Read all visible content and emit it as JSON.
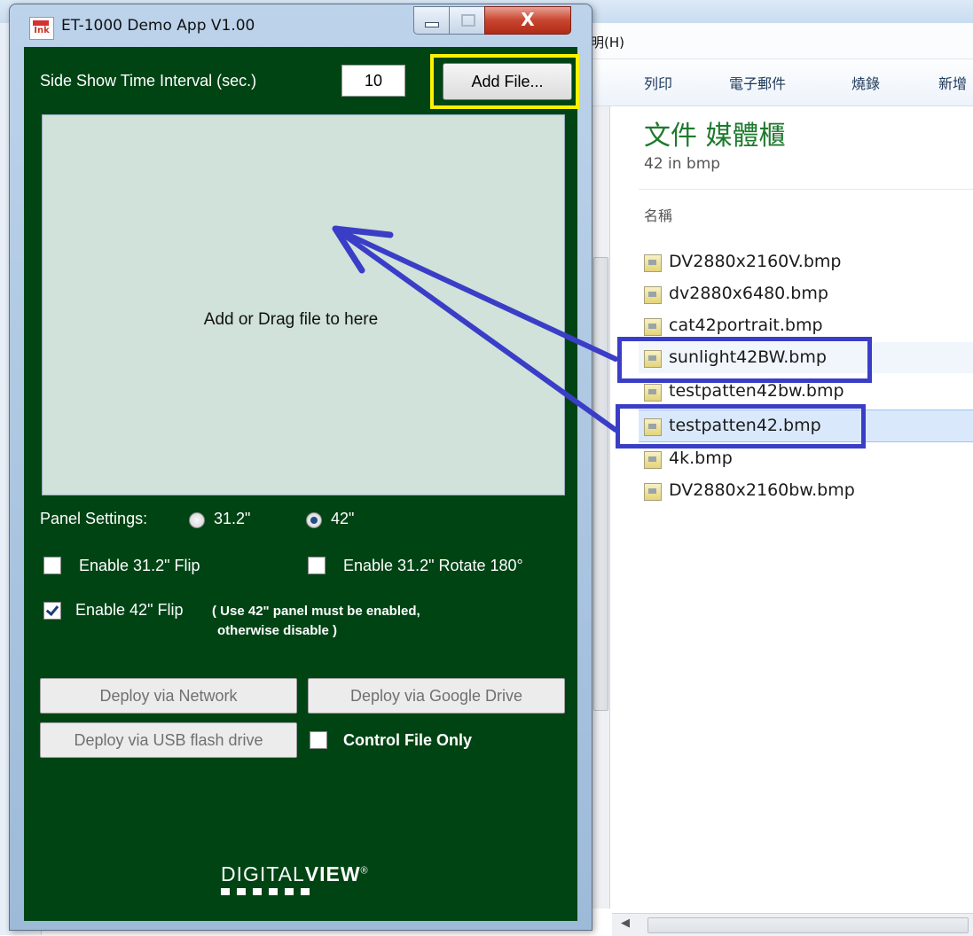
{
  "explorer": {
    "menu_help": "明(H)",
    "toolbar": [
      "列印",
      "電子郵件",
      "燒錄",
      "新增"
    ],
    "library_title": "文件 媒體櫃",
    "library_subtitle": "42 in bmp",
    "column_name": "名稱",
    "files": [
      {
        "name": "DV2880x2160V.bmp"
      },
      {
        "name": "dv2880x6480.bmp"
      },
      {
        "name": "cat42portrait.bmp"
      },
      {
        "name": "sunlight42BW.bmp"
      },
      {
        "name": "testpatten42bw.bmp"
      },
      {
        "name": "testpatten42.bmp"
      },
      {
        "name": "4k.bmp"
      },
      {
        "name": "DV2880x2160bw.bmp"
      }
    ]
  },
  "app": {
    "title": "ET-1000 Demo App V1.00",
    "icon_text": "Ink",
    "close_glyph": "X",
    "interval_label": "Side Show Time Interval (sec.)",
    "interval_value": "10",
    "add_file_label": "Add File...",
    "drop_text": "Add or Drag file to here",
    "panel_label": "Panel Settings:",
    "panel_options": [
      {
        "label": "31.2\"",
        "selected": false
      },
      {
        "label": "42\"",
        "selected": true
      }
    ],
    "enable_312_flip": {
      "label": "Enable 31.2\" Flip",
      "checked": false
    },
    "enable_312_rotate": {
      "label": "Enable 31.2\" Rotate 180°",
      "checked": false
    },
    "enable_42_flip": {
      "label": "Enable 42\" Flip",
      "checked": true
    },
    "note_line1": "( Use 42\" panel must be enabled,",
    "note_line2": "otherwise disable )",
    "deploy_network": "Deploy via Network",
    "deploy_google": "Deploy via Google Drive",
    "deploy_usb": "Deploy via USB flash drive",
    "control_file_only": {
      "label": "Control File Only",
      "checked": false
    },
    "logo_regular": "DIGITAL",
    "logo_bold": "VIEW",
    "logo_mark": "®"
  },
  "colors": {
    "client_bg": "#004414",
    "dropzone_bg": "#d0e2d9",
    "highlight_yellow": "#fff200",
    "highlight_blue": "#3a3ec7",
    "library_title": "#1d7a2d"
  }
}
